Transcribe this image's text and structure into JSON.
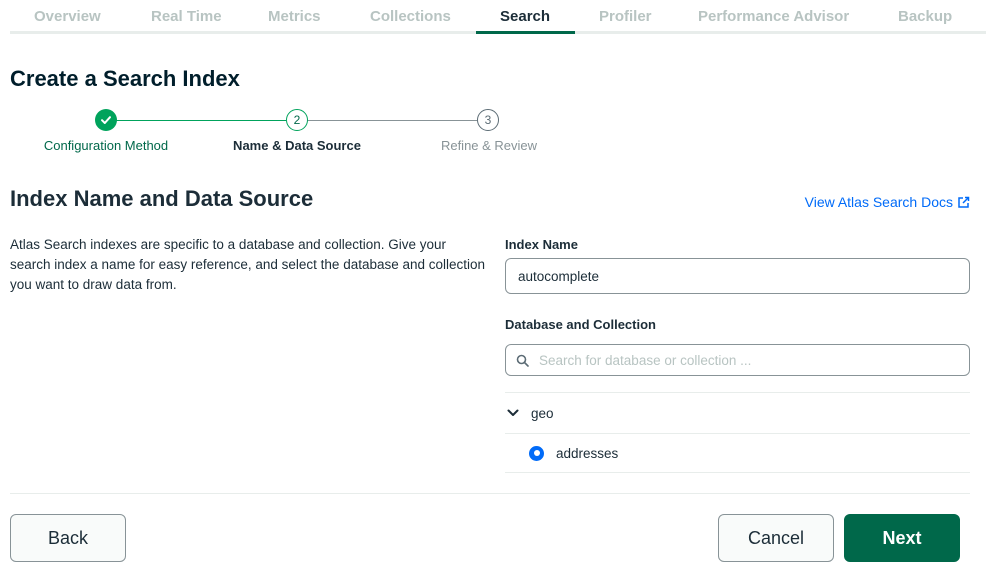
{
  "tabs": [
    {
      "label": "Overview",
      "active": false
    },
    {
      "label": "Real Time",
      "active": false
    },
    {
      "label": "Metrics",
      "active": false
    },
    {
      "label": "Collections",
      "active": false
    },
    {
      "label": "Search",
      "active": true
    },
    {
      "label": "Profiler",
      "active": false
    },
    {
      "label": "Performance Advisor",
      "active": false
    },
    {
      "label": "Backup",
      "active": false
    }
  ],
  "page_title": "Create a Search Index",
  "stepper": {
    "steps": [
      {
        "label": "Configuration Method",
        "number": "1",
        "state": "complete",
        "icon": "check-icon"
      },
      {
        "label": "Name & Data Source",
        "number": "2",
        "state": "current"
      },
      {
        "label": "Refine & Review",
        "number": "3",
        "state": "future"
      }
    ]
  },
  "section": {
    "title": "Index Name and Data Source",
    "docs_link": "View Atlas Search Docs",
    "docs_icon": "external-link-icon",
    "description": "Atlas Search indexes are specific to a database and collection. Give your search index a name for easy reference, and select the database and collection you want to draw data from."
  },
  "form": {
    "index_name_label": "Index Name",
    "index_name_value": "autocomplete",
    "db_collection_label": "Database and Collection",
    "search_placeholder": "Search for database or collection ...",
    "search_icon": "search-icon",
    "tree": {
      "database": "geo",
      "expand_icon": "chevron-down-icon",
      "collections": [
        {
          "name": "addresses",
          "selected": true
        }
      ]
    }
  },
  "buttons": {
    "back": "Back",
    "cancel": "Cancel",
    "next": "Next"
  },
  "colors": {
    "primary_green": "#00684a",
    "success_green": "#00a35c",
    "link_blue": "#016bf8",
    "text_dark": "#1c2d38",
    "tab_inactive": "#b8c4c2"
  }
}
